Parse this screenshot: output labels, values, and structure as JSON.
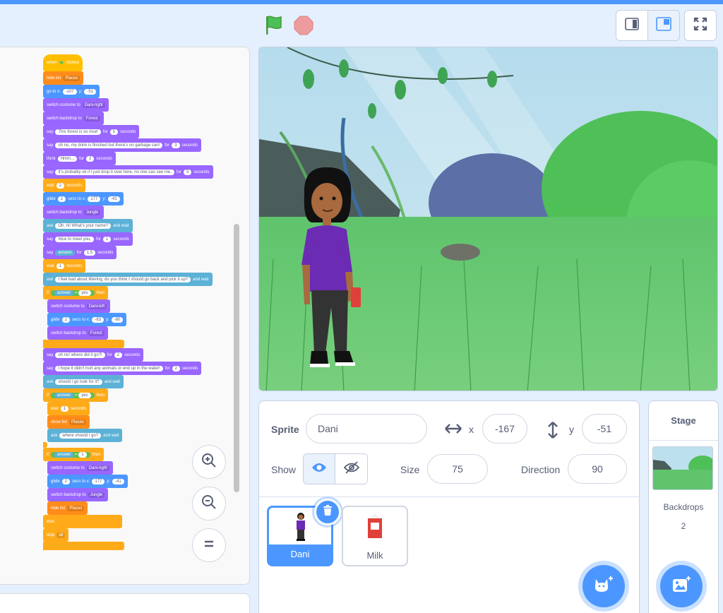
{
  "colors": {
    "accent": "#4c97ff",
    "events": "#ffbf00",
    "looks": "#9966ff",
    "motion": "#4c97ff",
    "sensing": "#5cb1d6",
    "control": "#ffab19",
    "data": "#ff8c1a",
    "operators": "#59c059"
  },
  "icons": {
    "green_flag": "green-flag-icon",
    "stop": "stop-icon",
    "small_stage": "small-stage-icon",
    "normal_stage": "normal-stage-icon",
    "fullscreen": "fullscreen-icon",
    "zoom_in": "zoom-in-icon",
    "zoom_out": "zoom-out-icon",
    "zoom_reset": "zoom-reset-icon"
  },
  "blocks": {
    "b1": "when",
    "b1b": "clicked",
    "b2": "hide list",
    "b2d": "Places",
    "b3": "go to x:",
    "b3x": "-107",
    "b3y": "y:",
    "b3yv": "-51",
    "b4": "switch costume to",
    "b4d": "Dani-right",
    "b5": "switch backdrop to",
    "b5d": "Forest",
    "b6": "say",
    "b6v": "This forest is so nice!",
    "b6f": "for",
    "b6n": "5",
    "b6s": "seconds",
    "b7": "say",
    "b7v": "oh no, my drink is finished but there's no garbage can!",
    "b7f": "for",
    "b7n": "3",
    "b7s": "seconds",
    "b8": "think",
    "b8v": "Hmm...",
    "b8f": "for",
    "b8n": "2",
    "b8s": "seconds",
    "b9": "say",
    "b9v": "It's probably ok if I just drop it over here, no one can see me.",
    "b9f": "for",
    "b9n": "5",
    "b9s": "seconds",
    "b10": "wait",
    "b10n": "2",
    "b10s": "seconds",
    "b11": "glide",
    "b11n": "2",
    "b11t": "secs to x:",
    "b11x": "177",
    "b11y": "y:",
    "b11yv": "-41",
    "b12": "switch backdrop to",
    "b12d": "Jungle",
    "b13": "ask",
    "b13v": "Oh, hi! What's your name?",
    "b13w": "and wait",
    "b14": "say",
    "b14v": "Nice to meet you,",
    "b14f": "for",
    "b14n": "1",
    "b14s": "seconds",
    "b15": "say",
    "b15v": "answer",
    "b15f": "for",
    "b15n": "1.5",
    "b15s": "seconds",
    "b16": "wait",
    "b16n": "1",
    "b16s": "seconds",
    "b17": "ask",
    "b17v": "I feel bad about littering, do you think I should go back and pick it up?",
    "b17w": "and wait",
    "b18": "if",
    "b18a": "answer",
    "b18e": "=",
    "b18v": "yes",
    "b18t": "then",
    "b19": "switch costume to",
    "b19d": "Dani-left",
    "b20": "glide",
    "b20n": "2",
    "b20t": "secs to x:",
    "b20x": "-83",
    "b20y": "y:",
    "b20yv": "-60",
    "b21": "switch backdrop to",
    "b21d": "Forest",
    "b22": "say",
    "b22v": "oh no! where did it go?!",
    "b22f": "for",
    "b22n": "2",
    "b22s": "seconds",
    "b23": "say",
    "b23v": "I hope it didn't hurt any animals or end up in the water!",
    "b23f": "for",
    "b23n": "2",
    "b23s": "seconds",
    "b24": "ask",
    "b24v": "should i go look for it?",
    "b24w": "and wait",
    "b25": "if",
    "b25a": "answer",
    "b25e": "=",
    "b25v": "yes",
    "b25t": "then",
    "b26": "wait",
    "b26n": "1",
    "b26s": "seconds",
    "b27": "show list",
    "b27d": "Places",
    "b28": "ask",
    "b28v": "where should I go?",
    "b28w": "and wait",
    "b29": "if",
    "b29a": "answer",
    "b29e": "=",
    "b29v": "1",
    "b29t": "then",
    "b30": "switch costume to",
    "b30d": "Dani-right",
    "b31": "glide",
    "b31n": "2",
    "b31t": "secs to x:",
    "b31x": "177",
    "b31y": "y:",
    "b31yv": "-41",
    "b32": "switch backdrop to",
    "b32d": "Jungle",
    "b33": "hide list",
    "b33d": "Places",
    "b34": "else",
    "b35": "stop",
    "b35d": "all"
  },
  "sprite_info": {
    "sprite_label": "Sprite",
    "name": "Dani",
    "x_label": "x",
    "x": "-167",
    "y_label": "y",
    "y": "-51",
    "show_label": "Show",
    "size_label": "Size",
    "size": "75",
    "direction_label": "Direction",
    "direction": "90"
  },
  "sprites": [
    {
      "name": "Dani"
    },
    {
      "name": "Milk"
    }
  ],
  "stage_pane": {
    "title": "Stage",
    "backdrops_label": "Backdrops",
    "backdrops_count": "2"
  }
}
